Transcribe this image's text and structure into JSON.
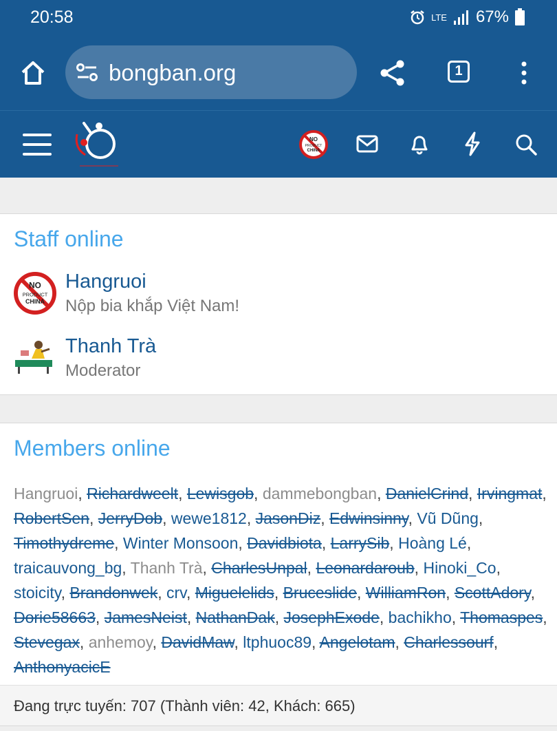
{
  "status": {
    "time": "20:58",
    "network": "LTE",
    "battery": "67%"
  },
  "browser": {
    "url": "bongban.org",
    "tab_count": "1"
  },
  "staff": {
    "title": "Staff online",
    "users": [
      {
        "name": "Hangruoi",
        "subtitle": "Nộp bia khắp Việt Nam!"
      },
      {
        "name": "Thanh Trà",
        "subtitle": "Moderator"
      }
    ]
  },
  "members": {
    "title": "Members online",
    "list": [
      {
        "name": "Hangruoi",
        "style": "gray"
      },
      {
        "name": "Richardweelt",
        "style": "strike"
      },
      {
        "name": "Lewisgob",
        "style": "strike"
      },
      {
        "name": "dammebongban",
        "style": "gray"
      },
      {
        "name": "DanielCrind",
        "style": "strike"
      },
      {
        "name": "Irvingmat",
        "style": "strike"
      },
      {
        "name": "RobertSen",
        "style": "strike"
      },
      {
        "name": "JerryDob",
        "style": "strike"
      },
      {
        "name": "wewe1812",
        "style": "normal"
      },
      {
        "name": "JasonDiz",
        "style": "strike"
      },
      {
        "name": "Edwinsinny",
        "style": "strike"
      },
      {
        "name": "Vũ Dũng",
        "style": "normal"
      },
      {
        "name": "Timothydreme",
        "style": "strike"
      },
      {
        "name": "Winter Monsoon",
        "style": "normal"
      },
      {
        "name": "Davidbiota",
        "style": "strike"
      },
      {
        "name": "LarrySib",
        "style": "strike"
      },
      {
        "name": "Hoàng Lé",
        "style": "normal"
      },
      {
        "name": "traicauvong_bg",
        "style": "normal"
      },
      {
        "name": "Thanh Trà",
        "style": "gray"
      },
      {
        "name": "CharlesUnpal",
        "style": "strike"
      },
      {
        "name": "Leonardaroub",
        "style": "strike"
      },
      {
        "name": "Hinoki_Co",
        "style": "normal"
      },
      {
        "name": "stoicity",
        "style": "normal"
      },
      {
        "name": "Brandonwek",
        "style": "strike"
      },
      {
        "name": "crv",
        "style": "normal"
      },
      {
        "name": "Miguelelids",
        "style": "strike"
      },
      {
        "name": "Bruceslide",
        "style": "strike"
      },
      {
        "name": "WilliamRon",
        "style": "strike"
      },
      {
        "name": "ScottAdory",
        "style": "strike"
      },
      {
        "name": "Dorie58663",
        "style": "strike"
      },
      {
        "name": "JamesNeist",
        "style": "strike"
      },
      {
        "name": "NathanDak",
        "style": "strike"
      },
      {
        "name": "JosephExode",
        "style": "strike"
      },
      {
        "name": "bachikho",
        "style": "normal"
      },
      {
        "name": "Thomaspes",
        "style": "strike"
      },
      {
        "name": "Stevegax",
        "style": "strike"
      },
      {
        "name": "anhemoy",
        "style": "gray"
      },
      {
        "name": "DavidMaw",
        "style": "strike"
      },
      {
        "name": "ltphuoc89",
        "style": "normal"
      },
      {
        "name": "Angelotam",
        "style": "strike"
      },
      {
        "name": "Charlessourf",
        "style": "strike"
      },
      {
        "name": "AnthonyacicE",
        "style": "strike"
      }
    ]
  },
  "footer": {
    "text": "Đang trực tuyến: 707 (Thành viên: 42, Khách: 665)"
  },
  "badge_text": {
    "line1": "NO",
    "line2": "PRODUCT",
    "line3": "CHINA"
  },
  "colors": {
    "header_blue": "#185992",
    "title_blue": "#47a7eb",
    "link_blue": "#185992",
    "gray_text": "#8c8c8c"
  }
}
